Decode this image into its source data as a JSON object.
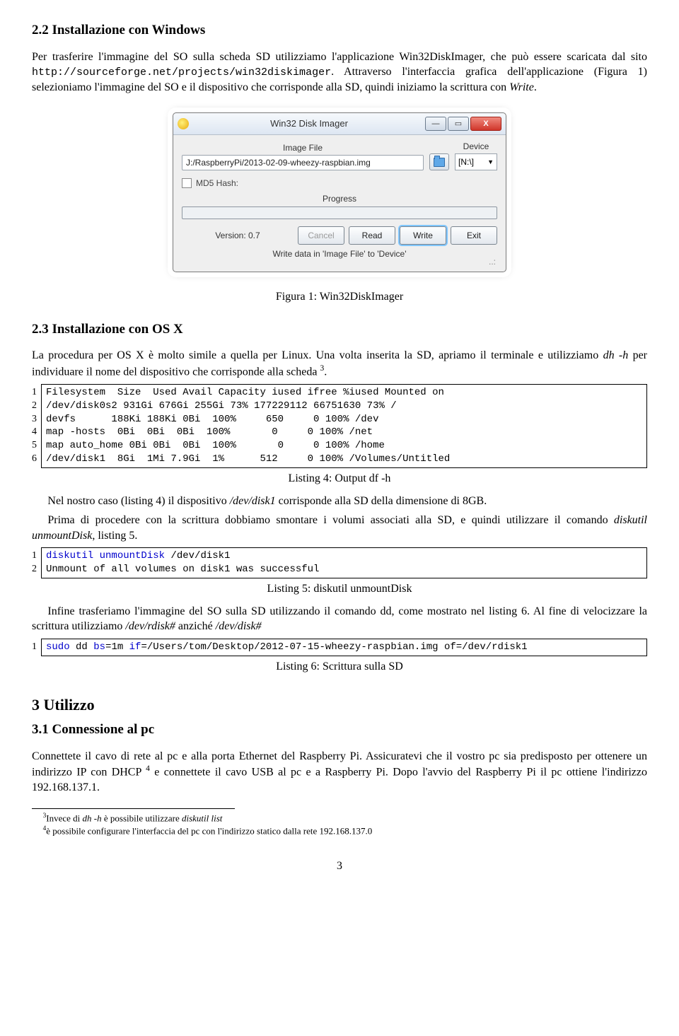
{
  "sec22": {
    "heading": "2.2   Installazione con Windows",
    "para": "Per trasferire l'immagine del SO sulla scheda SD utilizziamo l'applicazione Win32DiskImager, che può essere scaricata dal sito ",
    "url": "http://sourceforge.net/projects/win32diskimager",
    "para2": ". Attraverso l'interfaccia grafica dell'applicazione (Figura 1) selezioniamo l'immagine del SO e il dispositivo che corrisponde alla SD, quindi iniziamo la scrittura con ",
    "writeword": "Write",
    "period": "."
  },
  "win32": {
    "title": "Win32 Disk Imager",
    "label_imagefile": "Image File",
    "label_device": "Device",
    "imagefile_value": "J:/RaspberryPi/2013-02-09-wheezy-raspbian.img",
    "device_value": "[N:\\]",
    "md5_label": "MD5 Hash:",
    "progress_label": "Progress",
    "version": "Version: 0.7",
    "btn_cancel": "Cancel",
    "btn_read": "Read",
    "btn_write": "Write",
    "btn_exit": "Exit",
    "status": "Write data in 'Image File' to 'Device'",
    "min": "—",
    "max": "▭",
    "close": "X"
  },
  "fig1cap": "Figura 1: Win32DiskImager",
  "sec23": {
    "heading": "2.3   Installazione con OS X",
    "para1a": "La procedura per OS X è molto simile a quella per Linux. Una volta inserita la SD, apriamo il terminale e utilizziamo ",
    "dh": "dh -h",
    "para1b": " per individuare il nome del dispositivo che corrisponde alla scheda ",
    "fn3": "3",
    "period": "."
  },
  "listing4": {
    "lineno": "1\n2\n3\n4\n5\n6",
    "code": "Filesystem  Size  Used Avail Capacity iused ifree %iused Mounted on\n/dev/disk0s2 931Gi 676Gi 255Gi 73% 177229112 66751630 73% /\ndevfs      188Ki 188Ki 0Bi  100%     650     0 100% /dev\nmap -hosts  0Bi  0Bi  0Bi  100%       0     0 100% /net\nmap auto_home 0Bi 0Bi  0Bi  100%       0     0 100% /home\n/dev/disk1  8Gi  1Mi 7.9Gi  1%      512     0 100% /Volumes/Untitled",
    "caption": "Listing 4: Output df -h"
  },
  "para_after4a": "Nel nostro caso (listing 4) il dispositivo ",
  "devdisk1": "/dev/disk1",
  "para_after4b": " corrisponde alla SD della dimensione di 8GB.",
  "para_after4c": "Prima di procedere con la scrittura dobbiamo smontare i volumi associati alla SD, e quindi utilizzare il comando ",
  "diskutil": "diskutil unmountDisk",
  "para_after4d": ", listing 5.",
  "listing5": {
    "lineno": "1\n2",
    "kw": "diskutil unmountDisk",
    "rest1": " /dev/disk1",
    "line2": "Unmount of all volumes on disk1 was successful",
    "caption": "Listing 5: diskutil unmountDisk"
  },
  "para_after5a": "Infine trasferiamo l'immagine del SO sulla SD utilizzando il comando dd, come mostrato nel listing 6. Al fine di velocizzare la scrittura utilizziamo ",
  "rdisk": "/dev/rdisk#",
  "anz": " anziché ",
  "disk": "/dev/disk#",
  "listing6": {
    "lineno": "1",
    "kw1": "sudo ",
    "plain1": "dd ",
    "kw2": "bs",
    "plain2": "=1m ",
    "kw3": "if",
    "plain3": "=/Users/tom/Desktop/2012-07-15-wheezy-raspbian.img of=/dev/rdisk1",
    "caption": "Listing 6: Scrittura sulla SD"
  },
  "sec3": {
    "heading": "3   Utilizzo"
  },
  "sec31": {
    "heading": "3.1   Connessione al pc",
    "para1": "Connettete il cavo di rete al pc e alla porta Ethernet del Raspberry Pi. Assicuratevi che il vostro pc sia predisposto per ottenere un indirizzo IP con DHCP ",
    "fn4": "4",
    "para1b": " e connettete il cavo USB al pc e a Raspberry Pi. Dopo l'avvio del Raspberry Pi il pc ottiene l'indirizzo 192.168.137.1."
  },
  "footnotes": {
    "f3a": "3",
    "f3b": "Invece di ",
    "f3c": "dh -h",
    "f3d": " è possibile utilizzare ",
    "f3e": "diskutil list",
    "f4a": "4",
    "f4b": "è possibile configurare l'interfaccia del pc con l'indirizzo statico dalla rete 192.168.137.0"
  },
  "pagenum": "3"
}
